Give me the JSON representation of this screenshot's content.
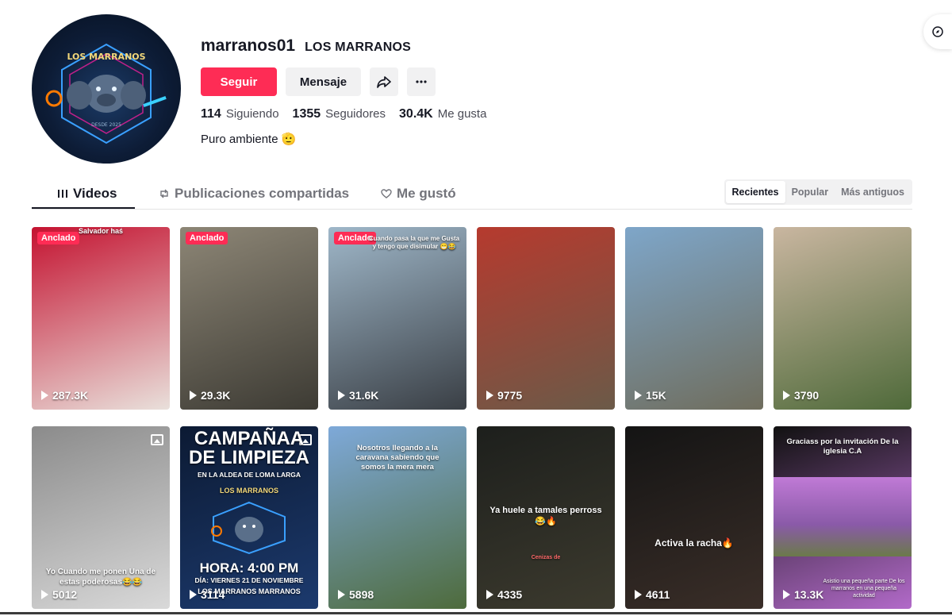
{
  "profile": {
    "username": "marranos01",
    "nickname": "LOS MARRANOS",
    "bio": "Puro ambiente 🫡",
    "avatar_text": "LOS MARRANOS",
    "avatar_subtext": "DESDE 2025"
  },
  "buttons": {
    "follow": "Seguir",
    "message": "Mensaje",
    "share_icon": "share-icon",
    "more_icon": "more-icon"
  },
  "stats": {
    "following_count": "114",
    "following_label": "Siguiendo",
    "followers_count": "1355",
    "followers_label": "Seguidores",
    "likes_count": "30.4K",
    "likes_label": "Me gusta"
  },
  "tabs": [
    {
      "label": "Videos",
      "icon": "grid-icon"
    },
    {
      "label": "Publicaciones compartidas",
      "icon": "repost-icon"
    },
    {
      "label": "Me gustó",
      "icon": "heart-icon"
    }
  ],
  "sort": [
    "Recientes",
    "Popular",
    "Más antiguos"
  ],
  "videos": [
    {
      "views": "287.3K",
      "badge": "Anclado",
      "caption": "Salvador haś",
      "colors": [
        "#c41230",
        "#e9e0db"
      ]
    },
    {
      "views": "29.3K",
      "badge": "Anclado",
      "caption": "",
      "colors": [
        "#8d8676",
        "#3d3b34"
      ]
    },
    {
      "views": "31.6K",
      "badge": "Anclado",
      "caption": "Cuando pasa la que me Gusta y tengo que disimular 😁😂",
      "colors": [
        "#9fb7c9",
        "#3a3f45"
      ]
    },
    {
      "views": "9775",
      "badge": "",
      "caption": "",
      "colors": [
        "#b63a2e",
        "#6b5a48"
      ]
    },
    {
      "views": "15K",
      "badge": "",
      "caption": "",
      "colors": [
        "#7ea6c9",
        "#6f6d5d"
      ]
    },
    {
      "views": "3790",
      "badge": "",
      "caption": "",
      "colors": [
        "#c9b6a0",
        "#4f6a3a"
      ]
    },
    {
      "views": "5012",
      "badge": "",
      "caption": "Yo Cuando me ponen Una de estas poderosas😂😂",
      "colors": [
        "#8b8b8b",
        "#d9d9d9"
      ]
    },
    {
      "views": "3114",
      "badge": "",
      "caption": "CAMPAÑAA DE LIMPIEZA",
      "colors": [
        "#0c1a33",
        "#1c3a6e"
      ]
    },
    {
      "views": "5898",
      "badge": "",
      "caption": "Nosotros llegando a la caravana sabiendo que somos la mera mera",
      "colors": [
        "#7ea9d9",
        "#4e6b3c"
      ]
    },
    {
      "views": "4335",
      "badge": "",
      "caption": "Ya huele a tamales perross 😂🔥",
      "colors": [
        "#1d1f1c",
        "#3c3a2e"
      ]
    },
    {
      "views": "4611",
      "badge": "",
      "caption": "Activa la racha🔥",
      "colors": [
        "#141414",
        "#3a2e28"
      ]
    },
    {
      "views": "13.3K",
      "badge": "",
      "caption": "Graciass por la invitación De la iglesia C.A",
      "colors": [
        "#111111",
        "#b26ac9"
      ]
    }
  ],
  "video8_extra": {
    "line1": "EN LA ALDEA DE LOMA LARGA",
    "line2": "LOS MARRANOS",
    "line3": "HORA: 4:00 PM",
    "line4": "DÍA: VIERNES 21 DE NOVIEMBRE",
    "line5": "LOS MARRANOS MARRANOS"
  },
  "video10_extra": "Cenizas de",
  "video12_extra": "Asistio una pequeña parte De los marranos en una pequeña actividad"
}
